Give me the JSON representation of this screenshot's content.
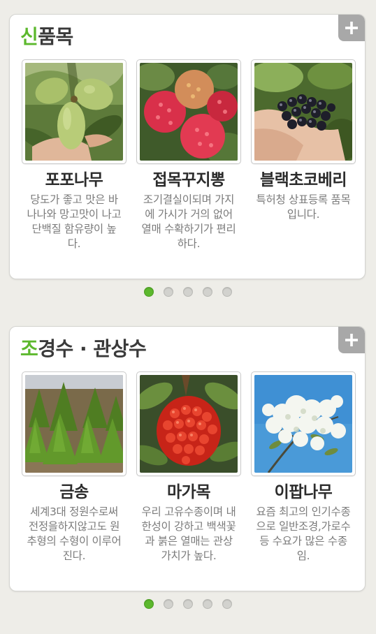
{
  "colors": {
    "accent": "#5cb82d",
    "background": "#eeede8",
    "plus_button": "#a8a8a8"
  },
  "sections": [
    {
      "title_first": "신",
      "title_rest": "품목",
      "plus_label": "+",
      "items": [
        {
          "name": "포포나무",
          "desc": "당도가 좋고 맛은 바나나와 망고맛이 나고 단백질 함유량이 높다.",
          "image": "pawpaw-fruit-photo"
        },
        {
          "name": "접목꾸지뽕",
          "desc": "조기결실이되며 가지에 가시가 거의 없어 열매 수확하기가 편리하다.",
          "image": "cudrania-fruit-photo"
        },
        {
          "name": "블랙초코베리",
          "desc": "특허청 상표등록 품목입니다.",
          "image": "black-chokeberry-photo"
        }
      ],
      "pager": {
        "total": 5,
        "active": 1
      }
    },
    {
      "title_first": "조",
      "title_rest": "경수 · 관상수",
      "plus_label": "+",
      "items": [
        {
          "name": "금송",
          "desc": "세계3대 정원수로써 전정을하지않고도 원추형의 수형이 이루어진다.",
          "image": "umbrella-pine-photo"
        },
        {
          "name": "마가목",
          "desc": "우리 고유수종이며 내한성이 강하고 백색꽃과 붉은 열매는 관상가치가 높다.",
          "image": "rowan-berries-photo"
        },
        {
          "name": "이팝나무",
          "desc": "요즘 최고의 인기수종으로 일반조경,가로수등 수요가 많은 수종임.",
          "image": "fringe-tree-photo"
        }
      ],
      "pager": {
        "total": 5,
        "active": 1
      }
    }
  ]
}
